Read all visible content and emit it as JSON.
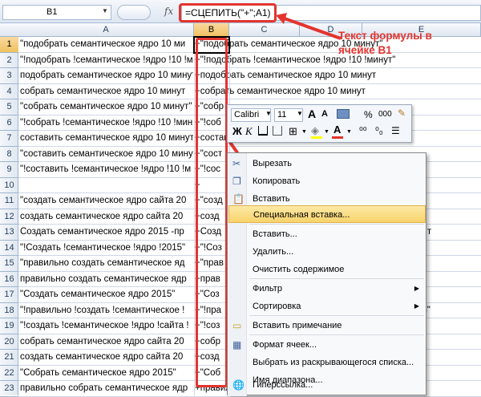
{
  "formula_bar": {
    "name_box": "B1",
    "fx_label": "fx",
    "formula": "=СЦЕПИТЬ(\"+\";A1)"
  },
  "columns": [
    "A",
    "B",
    "C",
    "D",
    "E"
  ],
  "rows": [
    {
      "n": "1",
      "a": "\"подобрать семантическое ядро 10 ми",
      "b": "+\"подобрать семантическое ядро 10 минут\""
    },
    {
      "n": "2",
      "a": "\"!подобрать !семантическое !ядро !10 !м",
      "b": "+\"!подобрать !семантическое !ядро !10 !минут\""
    },
    {
      "n": "3",
      "a": "подобрать семантическое ядро 10 минут",
      "b": "+подобрать семантическое ядро 10 минут"
    },
    {
      "n": "4",
      "a": "собрать семантическое ядро 10 минут",
      "b": "+собрать семантическое ядро 10 минут"
    },
    {
      "n": "5",
      "a": "\"собрать семантическое ядро 10 минут\"",
      "b": "+\"собр"
    },
    {
      "n": "6",
      "a": "\"!собрать !семантическое !ядро !10 !мин",
      "b": "+\"!соб"
    },
    {
      "n": "7",
      "a": "составить семантическое ядро 10 минут",
      "b": "+составить семантическое ядро 10 минут"
    },
    {
      "n": "8",
      "a": "\"составить семантическое ядро 10 минут",
      "b": "+\"сост"
    },
    {
      "n": "9",
      "a": "\"!составить !семантическое !ядро !10 !м",
      "b": "+\"!сос"
    },
    {
      "n": "10",
      "a": "",
      "b": "+"
    },
    {
      "n": "11",
      "a": "\"создать семантическое ядро сайта 20",
      "b": "+\"созд"
    },
    {
      "n": "12",
      "a": "создать семантическое ядро сайта 20",
      "b": "+созд"
    },
    {
      "n": "13",
      "a": "Создать семантическое ядро 2015 -пр",
      "b": "+Созд"
    },
    {
      "n": "14",
      "a": "\"!Создать !семантическое !ядро !2015\"",
      "b": "+\"!Соз"
    },
    {
      "n": "15",
      "a": "\"правильно создать семантическое яд",
      "b": "+\"прав"
    },
    {
      "n": "16",
      "a": "правильно создать семантическое ядр",
      "b": "+прав"
    },
    {
      "n": "17",
      "a": "\"Создать семантическое ядро 2015\"",
      "b": "+\"Соз"
    },
    {
      "n": "18",
      "a": "\"!правильно !создать !семантическое !",
      "b": "+\"!пра"
    },
    {
      "n": "19",
      "a": "\"!создать !семантическое !ядро !сайта !",
      "b": "+\"!соз"
    },
    {
      "n": "20",
      "a": "собрать семантическое ядро сайта 20",
      "b": "+собр"
    },
    {
      "n": "21",
      "a": "создать семантическое ядро сайта 20",
      "b": "+созд"
    },
    {
      "n": "22",
      "a": "\"Собрать семантическое ядро 2015\"",
      "b": "+\"Соб"
    },
    {
      "n": "23",
      "a": "правильно собрать семантическое ядр",
      "b": "+правильно собрать семантическое ядро 2015"
    }
  ],
  "overflow_tails": {
    "r7": "составить семантическое ядро 10 минут",
    "r13": "айт",
    "r18": "15\""
  },
  "callout": {
    "text": "Текст формулы в ячейке B1"
  },
  "mini_toolbar": {
    "font": "Calibri",
    "size": "11",
    "percent": "%",
    "thousands": "000",
    "bold": "Ж",
    "italic": "К",
    "font_color_letter": "A"
  },
  "context_menu": {
    "items": [
      {
        "label": "Вырезать",
        "icon": "scissors-icon"
      },
      {
        "label": "Копировать",
        "icon": "copy-icon"
      },
      {
        "label": "Вставить",
        "icon": "paste-icon"
      },
      {
        "label": "Специальная вставка...",
        "icon": ""
      },
      {
        "label": "Вставить...",
        "icon": ""
      },
      {
        "label": "Удалить...",
        "icon": ""
      },
      {
        "label": "Очистить содержимое",
        "icon": ""
      },
      {
        "label": "Фильтр",
        "icon": ""
      },
      {
        "label": "Сортировка",
        "icon": ""
      },
      {
        "label": "Вставить примечание",
        "icon": "comment-icon"
      },
      {
        "label": "Формат ячеек...",
        "icon": "format-cells-icon"
      },
      {
        "label": "Выбрать из раскрывающегося списка...",
        "icon": ""
      },
      {
        "label": "Имя диапазона...",
        "icon": ""
      },
      {
        "label": "Гиперссылка...",
        "icon": "hyperlink-icon"
      }
    ]
  },
  "colors": {
    "accent_red": "#e3342f",
    "highlight": "#f8d36c",
    "header_selected": "#f1c15f"
  }
}
